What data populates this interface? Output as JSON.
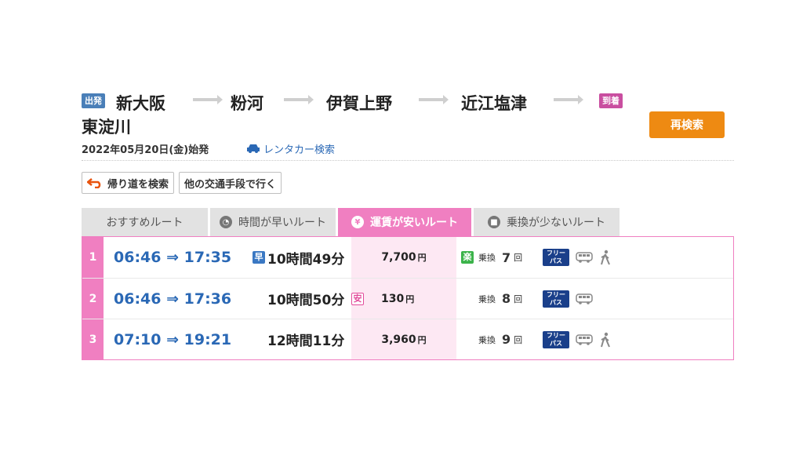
{
  "route": {
    "departure_badge": "出発",
    "arrival_badge": "到着",
    "stations": [
      "新大阪",
      "粉河",
      "伊賀上野",
      "近江塩津",
      "東淀川"
    ],
    "research_button": "再検索"
  },
  "date_text": "2022年05月20日(金)始発",
  "rental_car_link": "レンタカー検索",
  "actions": {
    "return_search": "帰り道を検索",
    "other_transport": "他の交通手段で行く"
  },
  "tabs": [
    {
      "label": "おすすめルート",
      "active": false
    },
    {
      "label": "時間が早いルート",
      "active": false
    },
    {
      "label": "運賃が安いルート",
      "active": true
    },
    {
      "label": "乗換が少ないルート",
      "active": false
    }
  ],
  "results": [
    {
      "num": "1",
      "times": "06:46 ⇒ 17:35",
      "duration_badge": "早",
      "duration": "10時間49分",
      "fare": "7,700",
      "fare_unit": "円",
      "transfer_badge": "楽",
      "transfer_label": "乗換",
      "transfer_count": "7",
      "transfer_unit": "回",
      "freepass": "フリー パス"
    },
    {
      "num": "2",
      "times": "06:46 ⇒ 17:36",
      "duration_badge": "",
      "duration": "10時間50分",
      "fare_badge": "安",
      "fare": "130",
      "fare_unit": "円",
      "transfer_badge": "",
      "transfer_label": "乗換",
      "transfer_count": "8",
      "transfer_unit": "回",
      "freepass": "フリー パス"
    },
    {
      "num": "3",
      "times": "07:10 ⇒ 19:21",
      "duration_badge": "",
      "duration": "12時間11分",
      "fare": "3,960",
      "fare_unit": "円",
      "transfer_badge": "",
      "transfer_label": "乗換",
      "transfer_count": "9",
      "transfer_unit": "回",
      "freepass": "フリー パス"
    }
  ],
  "colors": {
    "accent_pink": "#f07fc1",
    "link_blue": "#2a68b5",
    "button_orange": "#ee8a12"
  }
}
